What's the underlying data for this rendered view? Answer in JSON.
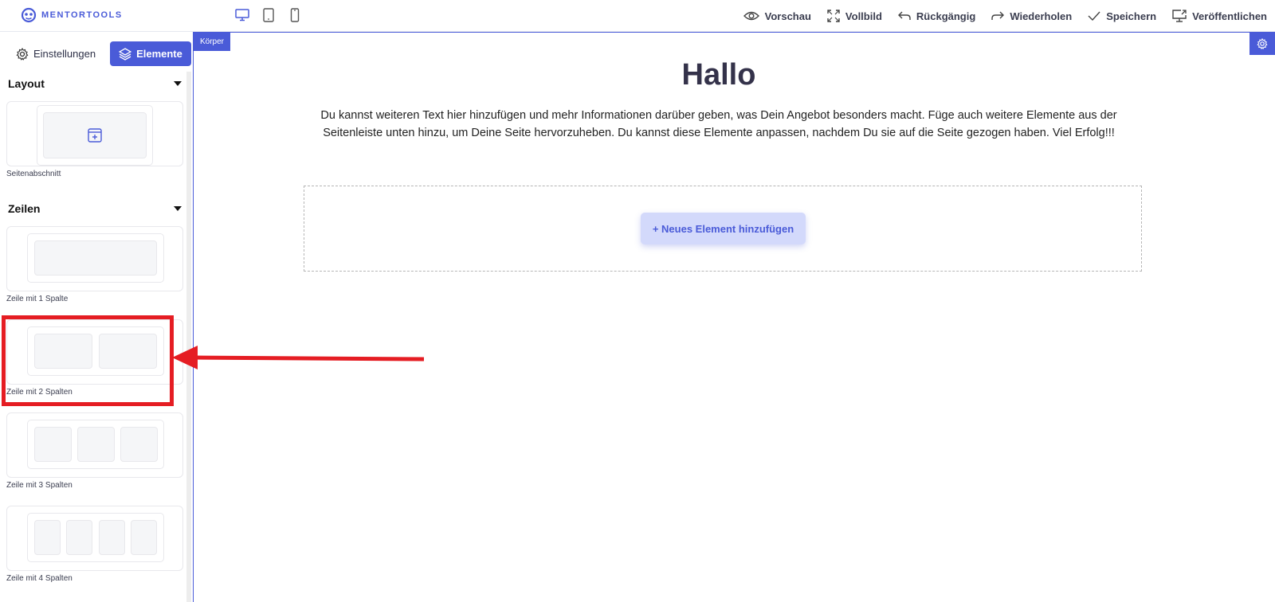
{
  "app": {
    "logo_text": "MENTORTOOLS"
  },
  "toolbar": {
    "devices": [
      "desktop-icon",
      "tablet-icon",
      "mobile-icon"
    ],
    "actions": [
      {
        "label": "Vorschau",
        "icon": "eye-icon"
      },
      {
        "label": "Vollbild",
        "icon": "fullscreen-icon"
      },
      {
        "label": "Rückgängig",
        "icon": "undo-icon"
      },
      {
        "label": "Wiederholen",
        "icon": "redo-icon"
      },
      {
        "label": "Speichern",
        "icon": "check-icon"
      },
      {
        "label": "Veröffentlichen",
        "icon": "monitor-upload-icon"
      }
    ]
  },
  "sidebar": {
    "tabs": {
      "settings": "Einstellungen",
      "elements": "Elemente"
    },
    "sections": [
      {
        "title": "Layout",
        "items": [
          {
            "label": "Seitenabschnitt"
          }
        ]
      },
      {
        "title": "Zeilen",
        "items": [
          {
            "label": "Zeile mit 1 Spalte"
          },
          {
            "label": "Zeile mit 2 Spalten"
          },
          {
            "label": "Zeile mit 3 Spalten"
          },
          {
            "label": "Zeile mit 4 Spalten"
          }
        ]
      }
    ]
  },
  "canvas": {
    "body_tag": "Körper",
    "title": "Hallo",
    "text": "Du kannst weiteren Text hier hinzufügen und mehr Informationen darüber geben, was Dein Angebot besonders macht. Füge auch weitere Elemente aus der Seitenleiste unten hinzu, um Deine Seite hervorzuheben. Du kannst diese Elemente anpassen, nachdem Du sie auf die Seite gezogen haben. Viel Erfolg!!!",
    "add_button": "+ Neues Element hinzufügen"
  },
  "colors": {
    "accent": "#4a5bd8",
    "annotation": "#e51d23"
  }
}
